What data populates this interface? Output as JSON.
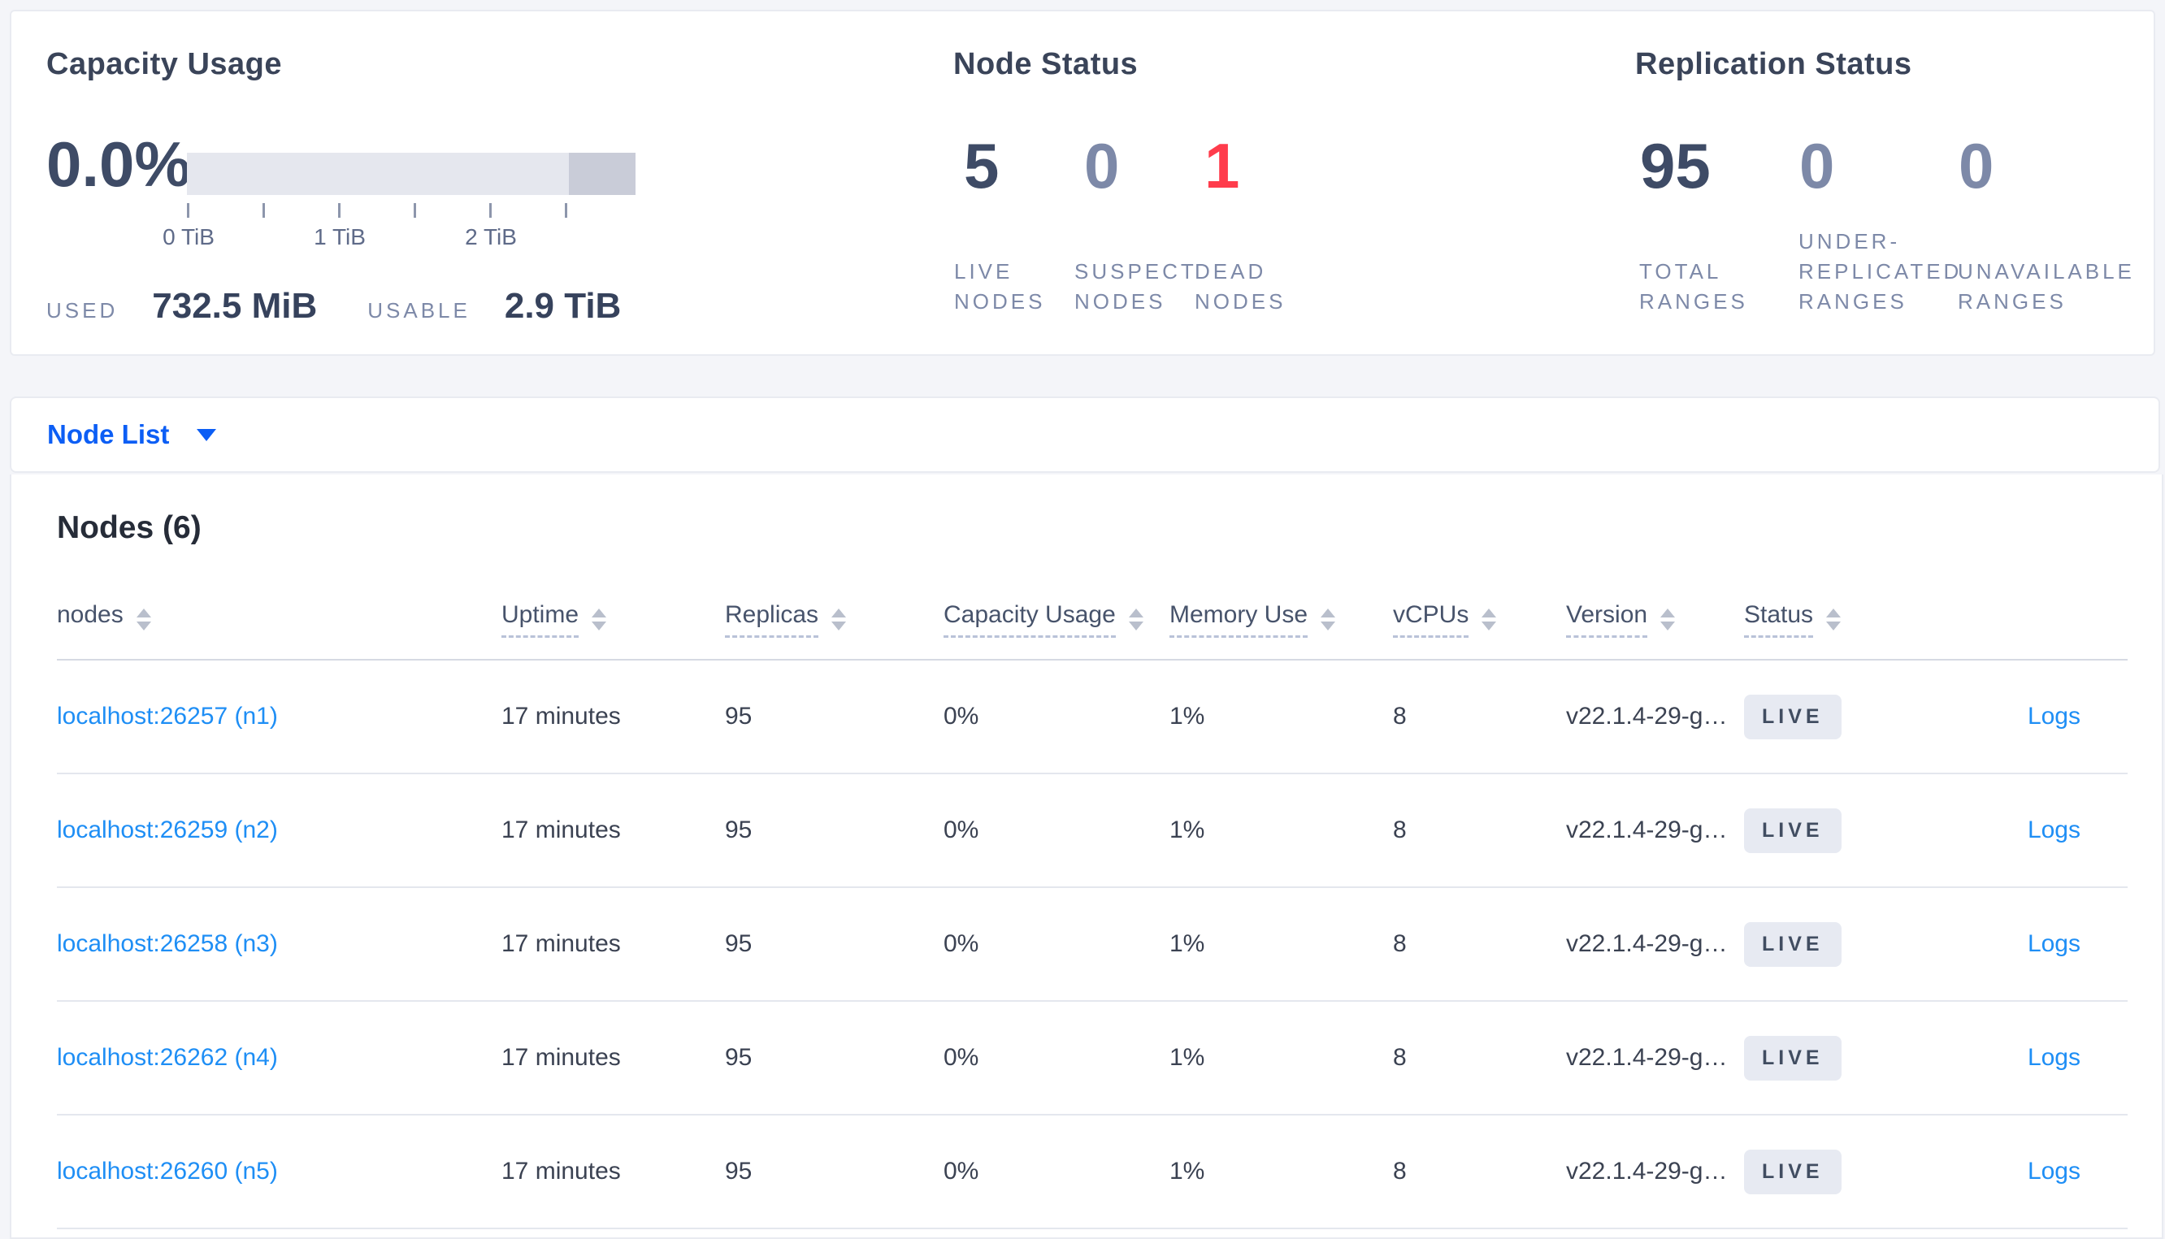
{
  "capacity": {
    "title": "Capacity Usage",
    "percent": "0.0%",
    "used_label": "USED",
    "used_value": "732.5 MiB",
    "usable_label": "USABLE",
    "usable_value": "2.9 TiB",
    "axis_ticks": [
      "0 TiB",
      "1 TiB",
      "2 TiB"
    ]
  },
  "node_status": {
    "title": "Node Status",
    "stats": [
      {
        "value": "5",
        "label": "LIVE\nNODES"
      },
      {
        "value": "0",
        "label": "SUSPECT\nNODES"
      },
      {
        "value": "1",
        "label": "DEAD\nNODES"
      }
    ]
  },
  "replication": {
    "title": "Replication Status",
    "stats": [
      {
        "value": "95",
        "label": "TOTAL\nRANGES"
      },
      {
        "value": "0",
        "label": "UNDER-\nREPLICATED\nRANGES"
      },
      {
        "value": "0",
        "label": "UNAVAILABLE\nRANGES"
      }
    ]
  },
  "node_list": {
    "label": "Node List"
  },
  "nodes": {
    "title": "Nodes (6)",
    "columns": [
      "nodes",
      "Uptime",
      "Replicas",
      "Capacity Usage",
      "Memory Use",
      "vCPUs",
      "Version",
      "Status"
    ],
    "rows": [
      {
        "address": "localhost:26257 (n1)",
        "uptime": "17 minutes",
        "replicas": "95",
        "capacity": "0%",
        "memory": "1%",
        "vcpus": "8",
        "version": "v22.1.4-29-g…",
        "status": "LIVE",
        "logs": "Logs"
      },
      {
        "address": "localhost:26259 (n2)",
        "uptime": "17 minutes",
        "replicas": "95",
        "capacity": "0%",
        "memory": "1%",
        "vcpus": "8",
        "version": "v22.1.4-29-g…",
        "status": "LIVE",
        "logs": "Logs"
      },
      {
        "address": "localhost:26258 (n3)",
        "uptime": "17 minutes",
        "replicas": "95",
        "capacity": "0%",
        "memory": "1%",
        "vcpus": "8",
        "version": "v22.1.4-29-g…",
        "status": "LIVE",
        "logs": "Logs"
      },
      {
        "address": "localhost:26262 (n4)",
        "uptime": "17 minutes",
        "replicas": "95",
        "capacity": "0%",
        "memory": "1%",
        "vcpus": "8",
        "version": "v22.1.4-29-g…",
        "status": "LIVE",
        "logs": "Logs"
      },
      {
        "address": "localhost:26260 (n5)",
        "uptime": "17 minutes",
        "replicas": "95",
        "capacity": "0%",
        "memory": "1%",
        "vcpus": "8",
        "version": "v22.1.4-29-g…",
        "status": "LIVE",
        "logs": "Logs"
      }
    ]
  },
  "colors": {
    "accent_blue": "#0c5ef5",
    "link_blue": "#1e8ef5",
    "danger_red": "#ff3c4c",
    "dark_slate": "#3e4b66",
    "muted_slate": "#7d89a8"
  }
}
